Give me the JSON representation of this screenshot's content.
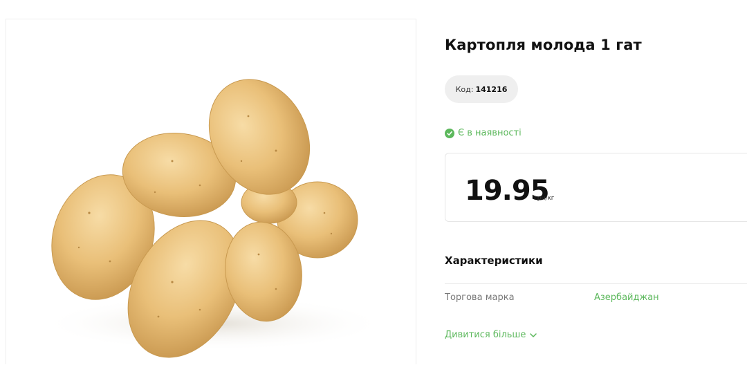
{
  "product": {
    "title": "Картопля молода 1 гат",
    "code_label": "Код:",
    "code_value": "141216",
    "stock_status": "Є в наявності",
    "price": "19.95",
    "price_unit": "грн/кг",
    "image_icon": "potato-photo"
  },
  "characteristics": {
    "title": "Характеристики",
    "rows": [
      {
        "label": "Торгова марка",
        "value": "Азербайджан"
      }
    ],
    "see_more": "Дивитися більше"
  },
  "colors": {
    "accent_green": "#5cb85c",
    "pill_bg": "#efefef"
  }
}
